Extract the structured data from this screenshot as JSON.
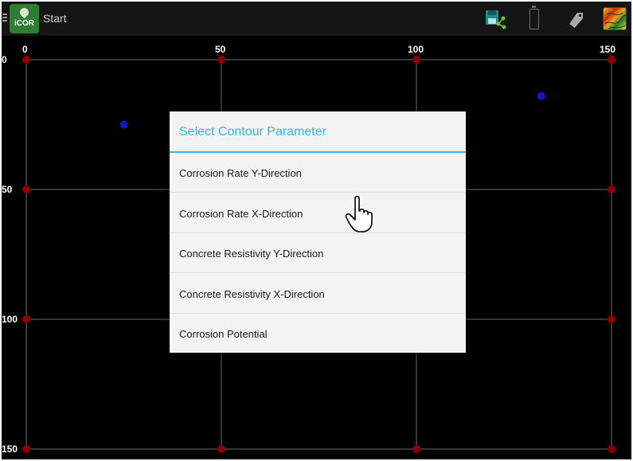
{
  "app": {
    "title": "Start",
    "logo_text": "iCOR"
  },
  "toolbar": {
    "icons": [
      "menu-icon",
      "save-share-icon",
      "battery-icon",
      "tag-icon",
      "contour-map-icon"
    ]
  },
  "grid": {
    "x_ticks": [
      "0",
      "50",
      "100",
      "150"
    ],
    "y_ticks": [
      "0",
      "50",
      "100",
      "150"
    ],
    "line_color": "#6b6b6b",
    "node_color": "#8b0000",
    "point_color": "#0d16c8",
    "points": [
      {
        "x": 25,
        "y": 25
      },
      {
        "x": 132,
        "y": 14
      }
    ]
  },
  "dialog": {
    "title": "Select Contour Parameter",
    "accent_color": "#33b5e5",
    "options": [
      "Corrosion Rate Y-Direction",
      "Corrosion Rate X-Direction",
      "Concrete Resistivity Y-Direction",
      "Concrete Resistivity X-Direction",
      "Corrosion Potential"
    ]
  }
}
